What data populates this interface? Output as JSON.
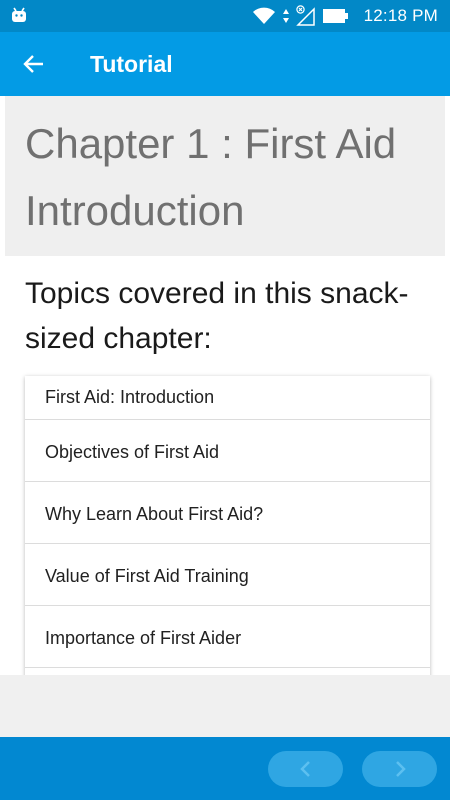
{
  "status_bar": {
    "time": "12:18 PM",
    "icons": [
      "android-icon",
      "wifi-icon",
      "data-arrows-icon",
      "no-signal-icon",
      "battery-icon"
    ]
  },
  "app_bar": {
    "title": "Tutorial",
    "back_icon": "arrow-left-icon"
  },
  "chapter": {
    "title": "Chapter 1 : First Aid Introduction"
  },
  "topics": {
    "heading": "Topics covered in this snack-sized chapter:",
    "items": [
      "First Aid: Introduction",
      "Objectives of First Aid",
      "Why Learn About First Aid?",
      "Value of First Aid Training",
      "Importance of First Aider"
    ]
  },
  "bottom_nav": {
    "prev_icon": "chevron-left-icon",
    "next_icon": "chevron-right-icon"
  },
  "colors": {
    "status_bar": "#0288c7",
    "app_bar": "#039be5",
    "bottom_bar": "#0288d1",
    "nav_button": "#2fa6e3",
    "chapter_header_bg": "#efefef",
    "chapter_title_text": "#707070"
  }
}
